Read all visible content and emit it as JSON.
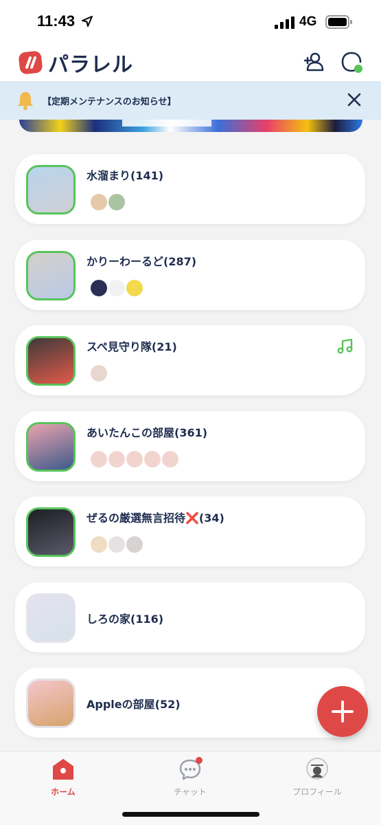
{
  "status_bar": {
    "time": "11:43",
    "network": "4G"
  },
  "header": {
    "app_name": "パラレル"
  },
  "notice": {
    "text": "【定期メンテナンスのお知らせ】"
  },
  "rooms": [
    {
      "title": "水溜まり(141)",
      "members": 2,
      "active": true,
      "music": false,
      "thumb_colors": [
        "#b8d4ec",
        "#cfcfd6"
      ],
      "avatar_colors": [
        "#e6c9a8",
        "#a9c4a2"
      ]
    },
    {
      "title": "かりーわーるど(287)",
      "members": 3,
      "active": true,
      "music": false,
      "thumb_colors": [
        "#d4d0cc",
        "#b9c9e4"
      ],
      "avatar_colors": [
        "#2b2f55",
        "#f1f1f1",
        "#f3d94b"
      ]
    },
    {
      "title": "スペ見守り隊(21)",
      "members": 1,
      "active": true,
      "music": true,
      "thumb_colors": [
        "#3e3a3a",
        "#e35a4a"
      ],
      "avatar_colors": [
        "#e8d7cf"
      ]
    },
    {
      "title": "あいたんこの部屋(361)",
      "members": 5,
      "active": true,
      "music": false,
      "thumb_colors": [
        "#e9a3ad",
        "#3e5a8c"
      ],
      "avatar_colors": [
        "#f2d4cf",
        "#f2d4cf",
        "#f2d4cf",
        "#f2d4cf",
        "#f2d4cf"
      ]
    },
    {
      "title": "ぜるの厳選無言招待❌(34)",
      "members": 3,
      "active": true,
      "music": false,
      "thumb_colors": [
        "#1e1e24",
        "#5a5a6a"
      ],
      "avatar_colors": [
        "#f0dcc2",
        "#e7e2e2",
        "#d9d2d2"
      ]
    },
    {
      "title": "しろの家(116)",
      "members": 0,
      "active": false,
      "music": false,
      "thumb_colors": [
        "#e4e2f0",
        "#d6e2ea"
      ],
      "avatar_colors": []
    },
    {
      "title": "Appleの部屋(52)",
      "members": 0,
      "active": false,
      "music": false,
      "thumb_colors": [
        "#f4c5cb",
        "#d6a46c"
      ],
      "avatar_colors": []
    }
  ],
  "tabs": [
    {
      "label": "ホーム",
      "active": true
    },
    {
      "label": "チャット",
      "active": false,
      "badge": true
    },
    {
      "label": "プロフィール",
      "active": false
    }
  ],
  "colors": {
    "accent": "#de4846",
    "navy": "#1e2d4f",
    "online": "#57c35a",
    "notice_bg": "#dcebf6"
  }
}
